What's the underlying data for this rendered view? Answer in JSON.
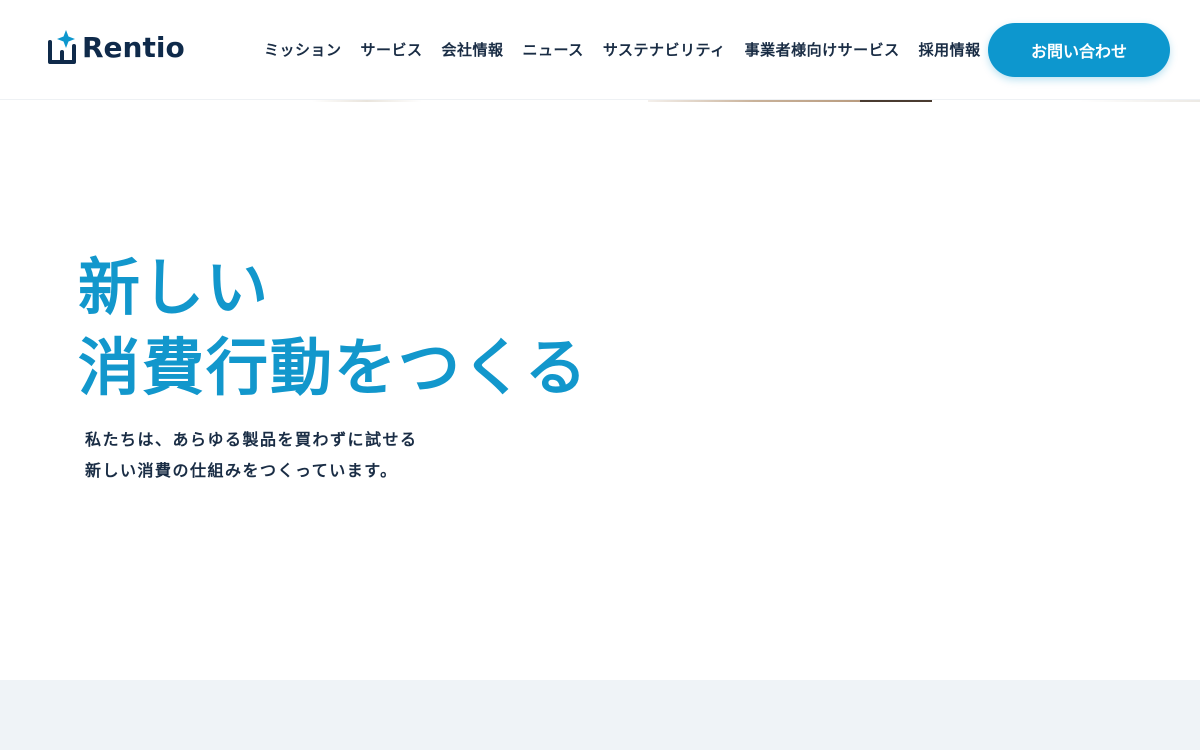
{
  "brand": {
    "name": "Rentio",
    "colors": {
      "accent": "#0d97ce",
      "heading": "#1297cc",
      "text": "#1a2d45",
      "logo_text": "#0f2a4a",
      "band": "#eff3f7"
    },
    "logo_icon": "house-with-sparkle-icon"
  },
  "nav": {
    "items": [
      {
        "label": "ミッション"
      },
      {
        "label": "サービス"
      },
      {
        "label": "会社情報"
      },
      {
        "label": "ニュース"
      },
      {
        "label": "サステナビリティ"
      },
      {
        "label": "事業者様向けサービス"
      },
      {
        "label": "採用情報"
      }
    ],
    "contact_label": "お問い合わせ"
  },
  "hero": {
    "title_lines": [
      "新しい",
      "消費行動をつくる"
    ],
    "description_lines": [
      "私たちは、あらゆる製品を買わずに試せる",
      "新しい消費の仕組みをつくっています。"
    ]
  }
}
